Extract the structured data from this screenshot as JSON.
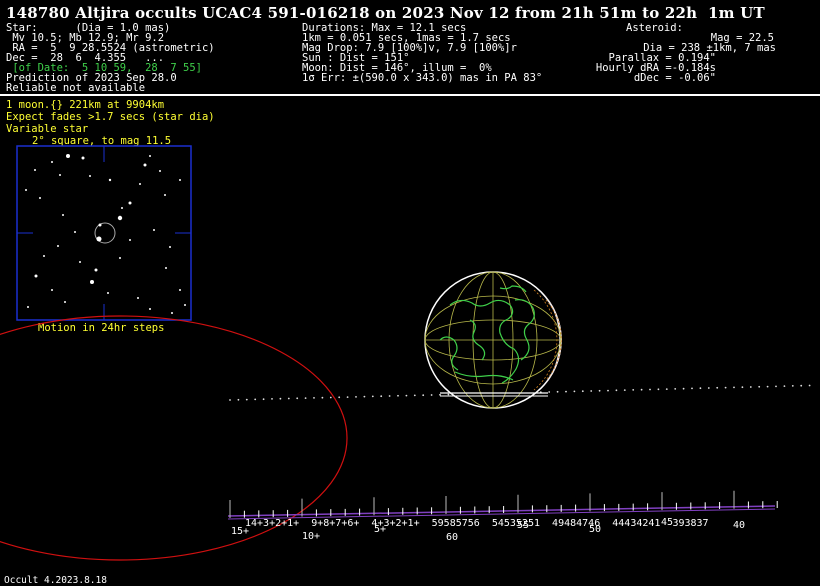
{
  "title": "148780 Altjira occults UCAC4 591-016218 on 2023 Nov 12 from 21h 51m to 22h  1m UT",
  "star": {
    "l1": "Star:      (Dia = 1.0 mas)",
    "l2": " Mv 10.5; Mb 12.9; Mr 9.2",
    "l3": " RA =  5  9 28.5524 (astrometric)",
    "l4": "Dec =  28  6  4.355   ...",
    "l5": " [of Date:  5 10 59,  28  7 55]",
    "l6": "Prediction of 2023 Sep 28.0",
    "l7": "Reliable not available"
  },
  "durations": {
    "l1": "Durations: Max = 12.1 secs",
    "l2": "1km = 0.051 secs, 1mas = 1.7 secs",
    "l3": "Mag Drop: 7.9 [100%]v, 7.9 [100%]r",
    "l4": "Sun : Dist = 151°",
    "l5": "Moon: Dist = 146°, illum =  0%",
    "l6": "1σ Err: ±(590.0 x 343.0) mas in PA 83°"
  },
  "asteroid": {
    "l1": "Asteroid:",
    "l2": "Mag = 22.5",
    "l3": "Dia = 238 ±1km, 7 mas",
    "l4": "Parallax = 0.194\"",
    "l5": "Hourly dRA =-0.184s",
    "l6": "dDec = -0.06\""
  },
  "notes": {
    "moon": "1 moon.{} 221km at 9904km",
    "fades": "Expect fades >1.7 secs (star dia)",
    "variable": "Variable star",
    "field": "2° square, to mag 11.5",
    "motion": "Motion in 24hr steps"
  },
  "ticks_upper": [
    "14",
    "13",
    "12",
    "11",
    "9",
    "8",
    "7",
    "6",
    "4",
    "3",
    "2",
    "1",
    "59",
    "58",
    "57",
    "56",
    "54",
    "53",
    "52",
    "51",
    "49",
    "48",
    "47",
    "46",
    "44",
    "43",
    "42",
    "41",
    "39",
    "38",
    "37"
  ],
  "ticks_lower": [
    "15+",
    "10+",
    "5+",
    "60",
    "55",
    "50",
    "45",
    "40"
  ],
  "ticks_upper_text": "14+3+2+1+  9+8+7+6+  4+3+2+1+  59585756  54535251  49484746  44434241  393837",
  "footer": "Occult 4.2023.8.18",
  "colors": {
    "green": "#3fd04a",
    "yellow": "#ffff33",
    "blue": "#1a2fd0",
    "red": "#d01010",
    "purple": "#8040c0"
  }
}
